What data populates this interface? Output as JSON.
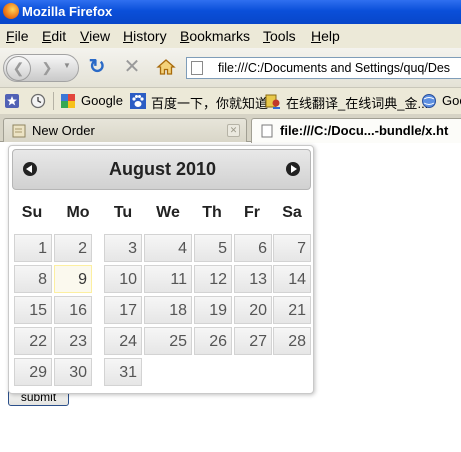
{
  "window": {
    "title": "Mozilla Firefox"
  },
  "menu": [
    "File",
    "Edit",
    "View",
    "History",
    "Bookmarks",
    "Tools",
    "Help"
  ],
  "navbar": {
    "url": "file:///C:/Documents and Settings/quq/Des"
  },
  "bookmarks": {
    "google": "Google",
    "baidu": "百度一下，你就知道",
    "translate": "在线翻译_在线词典_金...",
    "goo": "Goo"
  },
  "tabs": [
    {
      "label": "New Order",
      "active": false
    },
    {
      "label": "file:///C:/Docu...-bundle/x.ht",
      "active": true
    }
  ],
  "page": {
    "submit_label": "submit"
  },
  "datepicker": {
    "title": "August 2010",
    "weekdays": [
      "Su",
      "Mo",
      "Tu",
      "We",
      "Th",
      "Fr",
      "Sa"
    ],
    "weeks": [
      [
        "1",
        "2",
        "3",
        "4",
        "5",
        "6",
        "7"
      ],
      [
        "8",
        "9",
        "10",
        "11",
        "12",
        "13",
        "14"
      ],
      [
        "15",
        "16",
        "17",
        "18",
        "19",
        "20",
        "21"
      ],
      [
        "22",
        "23",
        "24",
        "25",
        "26",
        "27",
        "28"
      ],
      [
        "29",
        "30",
        "31"
      ]
    ],
    "today": "9"
  },
  "colors": {
    "titlebar": "#0a4fd9",
    "today_highlight": "#fbf9ee",
    "url_border": "#7f9db9"
  }
}
